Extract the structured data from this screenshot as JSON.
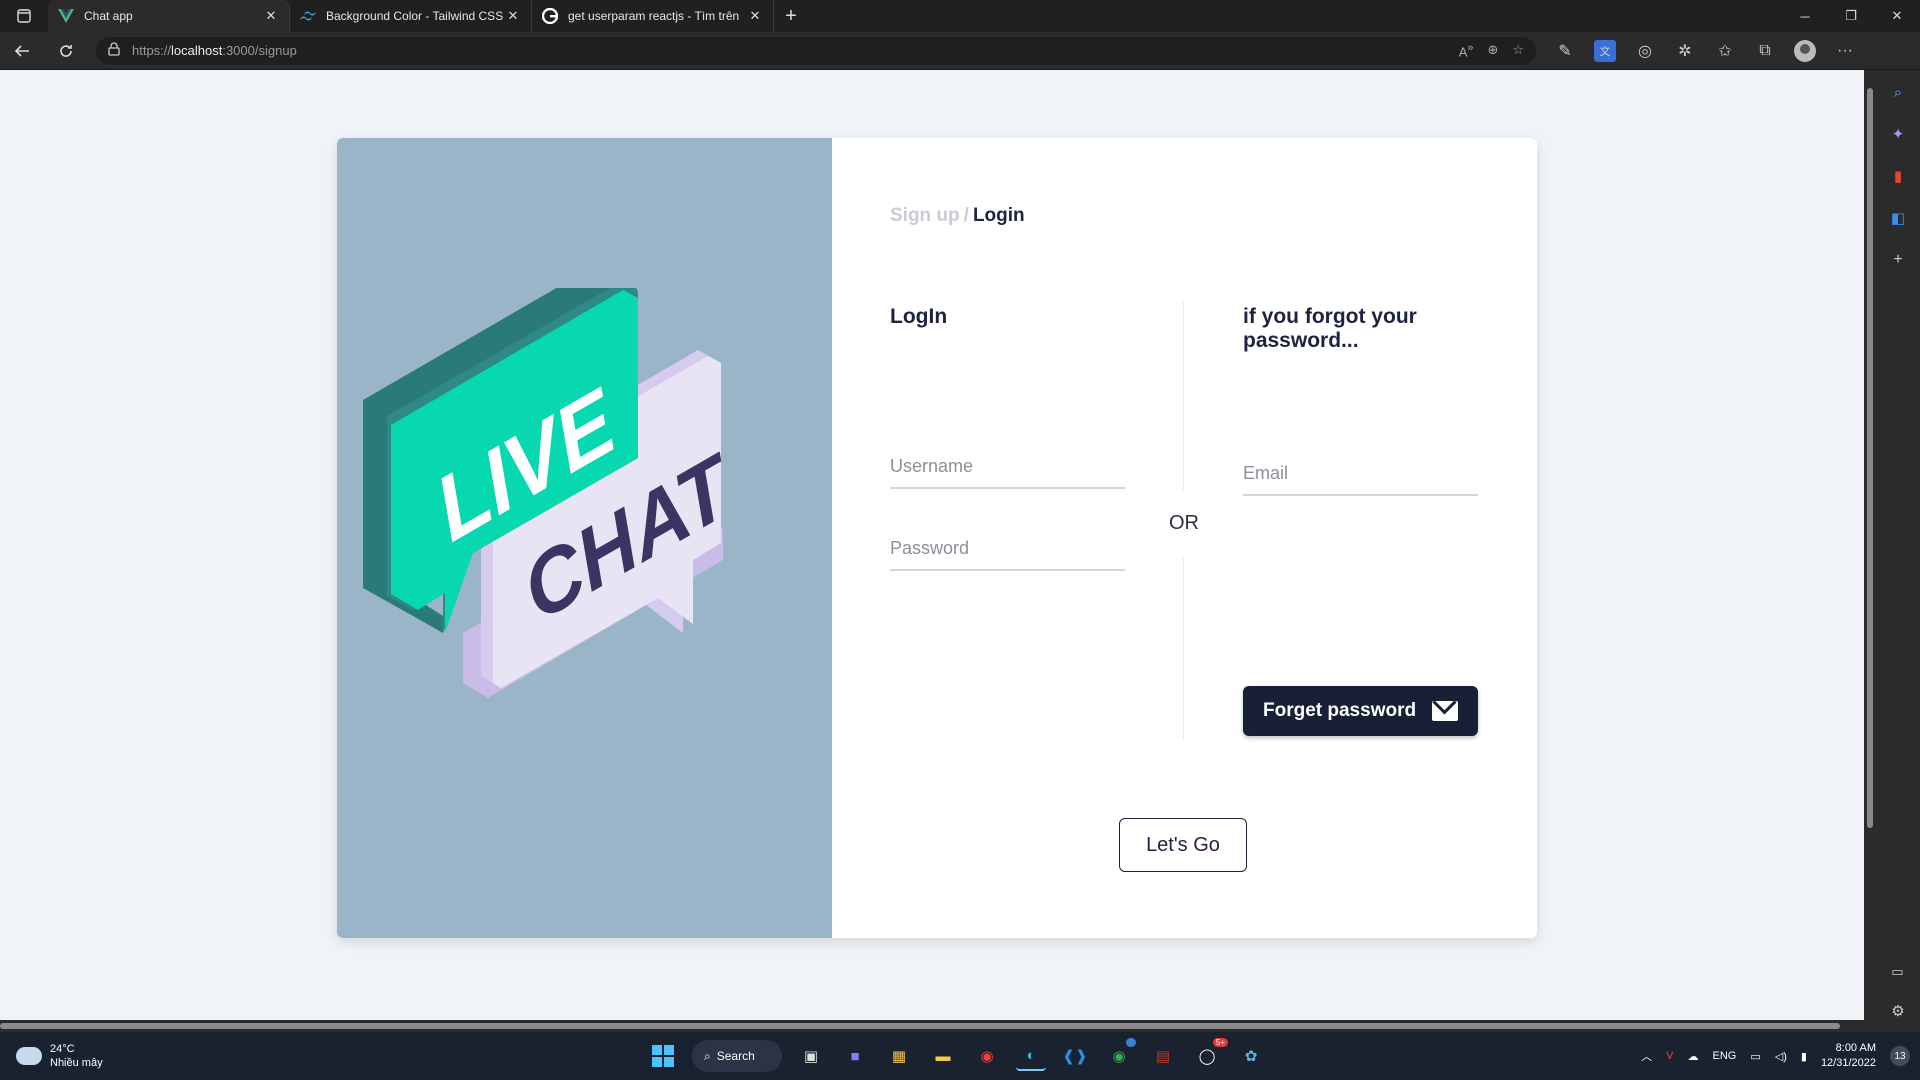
{
  "browser": {
    "tabs": [
      {
        "title": "Chat app",
        "active": true,
        "favicon": "vue-icon"
      },
      {
        "title": "Background Color - Tailwind CSS",
        "active": false,
        "favicon": "tailwind-icon"
      },
      {
        "title": "get userparam reactjs - Tìm trên",
        "active": false,
        "favicon": "google-icon"
      }
    ],
    "new_tab": "+",
    "url_scheme": "https://",
    "url_host": "localhost",
    "url_path": ":3000/signup"
  },
  "page": {
    "breadcrumb": {
      "inactive": "Sign up",
      "separator": "/",
      "active": "Login"
    },
    "hero": {
      "top_word": "LIVE",
      "bottom_word": "CHAT"
    },
    "login": {
      "title": "LogIn",
      "username_placeholder": "Username",
      "password_placeholder": "Password"
    },
    "or_label": "OR",
    "forgot": {
      "title": "if you forgot your password...",
      "email_placeholder": "Email",
      "button_label": "Forget password"
    },
    "submit_label": "Let's Go"
  },
  "taskbar": {
    "temperature": "24°C",
    "weather": "Nhiều mây",
    "search_label": "Search",
    "language": "ENG",
    "time": "8:00 AM",
    "date": "12/31/2022",
    "notifications": "13",
    "zalo_badge": "5+",
    "chrome_badge": "1"
  },
  "colors": {
    "hero_bg": "#9ab5c7",
    "page_bg": "#f0f4f8",
    "primary_dark": "#172035",
    "bubble_green": "#08d8b0",
    "bubble_lilac": "#e6e2f3",
    "chat_text": "#3d3464"
  }
}
